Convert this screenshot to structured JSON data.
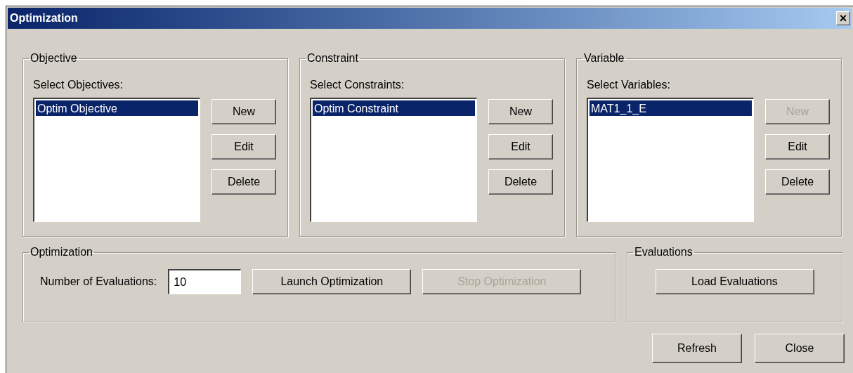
{
  "window": {
    "title": "Optimization",
    "close": "×"
  },
  "groups": [
    {
      "title": "Objective",
      "list_label": "Select Objectives:",
      "items": [
        {
          "text": "Optim Objective",
          "selected": true
        }
      ],
      "buttons": [
        {
          "label": "New",
          "disabled": false
        },
        {
          "label": "Edit",
          "disabled": false
        },
        {
          "label": "Delete",
          "disabled": false
        }
      ]
    },
    {
      "title": "Constraint",
      "list_label": "Select Constraints:",
      "items": [
        {
          "text": "Optim Constraint",
          "selected": true
        }
      ],
      "buttons": [
        {
          "label": "New",
          "disabled": false
        },
        {
          "label": "Edit",
          "disabled": false
        },
        {
          "label": "Delete",
          "disabled": false
        }
      ]
    },
    {
      "title": "Variable",
      "list_label": "Select Variables:",
      "items": [
        {
          "text": "MAT1_1_E",
          "selected": true
        }
      ],
      "buttons": [
        {
          "label": "New",
          "disabled": true
        },
        {
          "label": "Edit",
          "disabled": false
        },
        {
          "label": "Delete",
          "disabled": false
        }
      ]
    }
  ],
  "optimization": {
    "title": "Optimization",
    "field_label": "Number of Evaluations:",
    "value": "10",
    "buttons": [
      {
        "label": "Launch Optimization",
        "disabled": false
      },
      {
        "label": "Stop Optimization",
        "disabled": true
      }
    ]
  },
  "evaluations": {
    "title": "Evaluations",
    "buttons": [
      {
        "label": "Load Evaluations",
        "disabled": false
      }
    ]
  },
  "footer_buttons": [
    {
      "label": "Refresh",
      "disabled": false
    },
    {
      "label": "Close",
      "disabled": false
    }
  ]
}
